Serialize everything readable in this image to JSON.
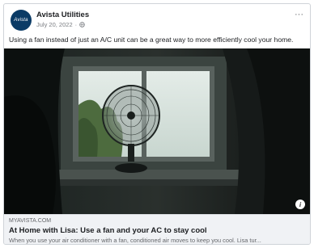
{
  "post": {
    "page_name": "Avista Utilities",
    "avatar_text": "Avista",
    "date": "July 20, 2022",
    "privacy_icon": "globe-icon",
    "more_label": "···",
    "caption": "Using a fan instead of just an A/C unit can be a great way to more efficiently cool your home."
  },
  "link": {
    "domain": "MYAVISTA.COM",
    "title": "At Home with Lisa: Use a fan and your AC to stay cool",
    "description": "When you use your air conditioner with a fan, conditioned air moves to keep you cool. Lisa tur...",
    "info_icon": "i"
  },
  "colors": {
    "brand": "#0b3b66",
    "text": "#1c1e21",
    "muted": "#65676b",
    "preview_bg": "#f0f2f5"
  }
}
